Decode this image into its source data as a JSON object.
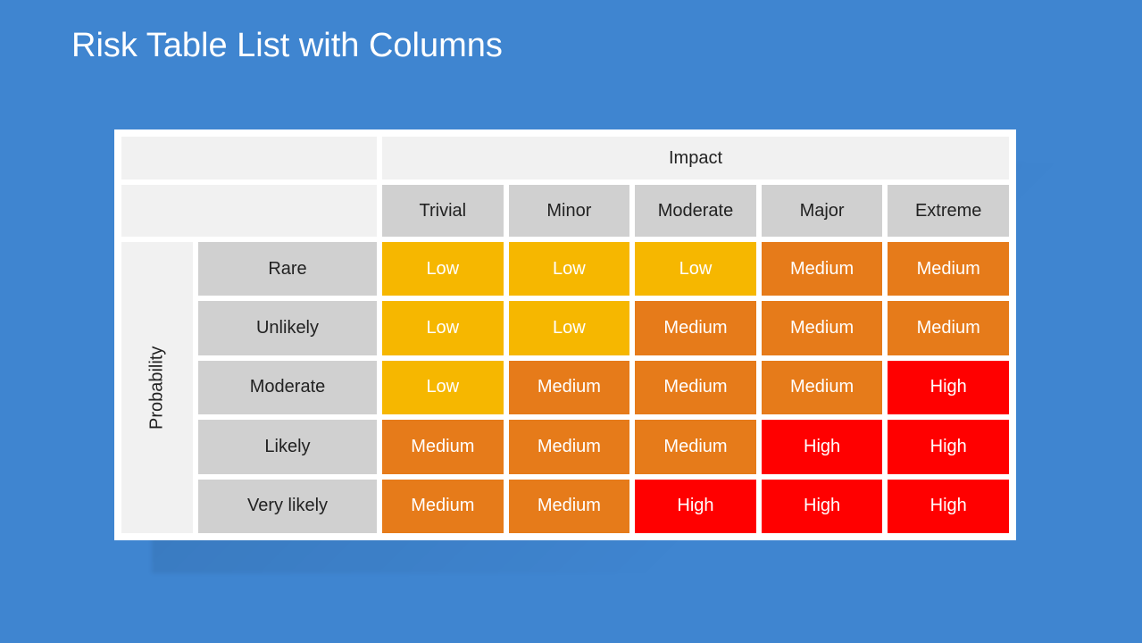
{
  "title": "Risk Table List with Columns",
  "axis": {
    "impact": "Impact",
    "probability": "Probability"
  },
  "impactLevels": [
    "Trivial",
    "Minor",
    "Moderate",
    "Major",
    "Extreme"
  ],
  "probLevels": [
    "Rare",
    "Unlikely",
    "Moderate",
    "Likely",
    "Very likely"
  ],
  "riskLabels": {
    "low": "Low",
    "medium": "Medium",
    "high": "High"
  },
  "colors": {
    "low": "#f6b700",
    "medium": "#e67b1a",
    "high": "#ff0000",
    "grey": "#d0d0d0",
    "light": "#f1f1f1"
  },
  "matrix": [
    [
      "low",
      "low",
      "low",
      "medium",
      "medium"
    ],
    [
      "low",
      "low",
      "medium",
      "medium",
      "medium"
    ],
    [
      "low",
      "medium",
      "medium",
      "medium",
      "high"
    ],
    [
      "medium",
      "medium",
      "medium",
      "high",
      "high"
    ],
    [
      "medium",
      "medium",
      "high",
      "high",
      "high"
    ]
  ],
  "chart_data": {
    "type": "heatmap",
    "title": "Risk Table List with Columns",
    "xlabel": "Impact",
    "ylabel": "Probability",
    "x_categories": [
      "Trivial",
      "Minor",
      "Moderate",
      "Major",
      "Extreme"
    ],
    "y_categories": [
      "Rare",
      "Unlikely",
      "Moderate",
      "Likely",
      "Very likely"
    ],
    "values": [
      [
        "Low",
        "Low",
        "Low",
        "Medium",
        "Medium"
      ],
      [
        "Low",
        "Low",
        "Medium",
        "Medium",
        "Medium"
      ],
      [
        "Low",
        "Medium",
        "Medium",
        "Medium",
        "High"
      ],
      [
        "Medium",
        "Medium",
        "Medium",
        "High",
        "High"
      ],
      [
        "Medium",
        "Medium",
        "High",
        "High",
        "High"
      ]
    ],
    "legend": {
      "Low": "#f6b700",
      "Medium": "#e67b1a",
      "High": "#ff0000"
    }
  }
}
